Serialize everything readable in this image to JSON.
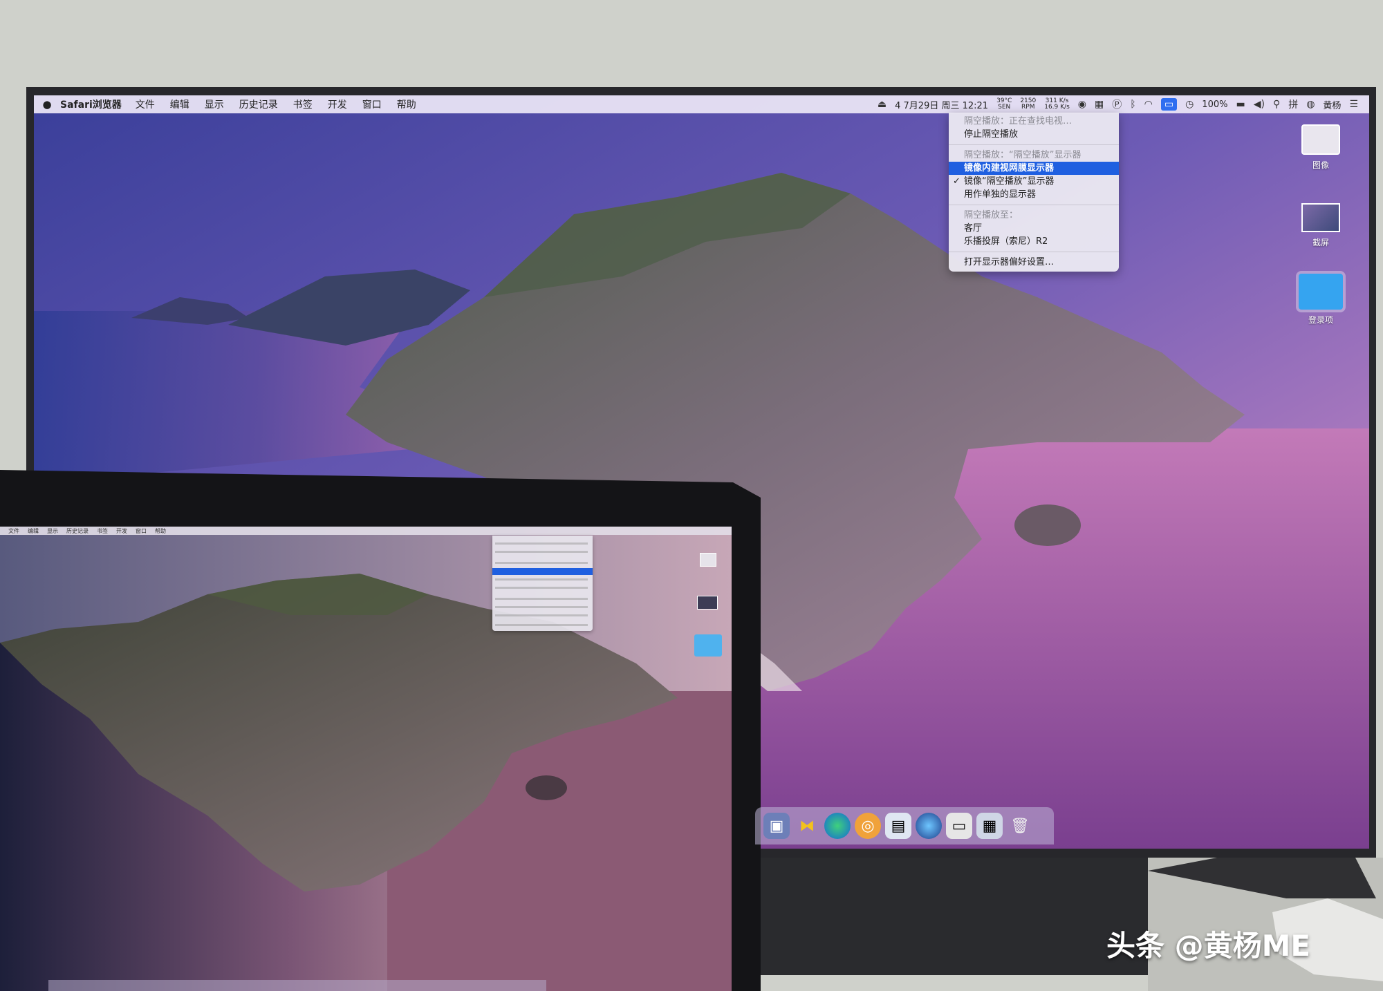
{
  "tv": {
    "menubar": {
      "apple": "",
      "app_name": "Safari浏览器",
      "items": [
        "文件",
        "编辑",
        "显示",
        "历史记录",
        "书签",
        "开发",
        "窗口",
        "帮助"
      ],
      "status": {
        "clock_text": "4  7月29日 周三 12:21",
        "temp": "39°C",
        "temp_unit": "SEN",
        "fan": "2150",
        "fan_unit": "RPM",
        "net_up": "311 K/s",
        "net_down": "16.9 K/s",
        "battery": "100%",
        "user": "黄杨"
      }
    },
    "airplay_menu": {
      "status_header": "隔空播放：正在查找电视…",
      "stop": "停止隔空播放",
      "mode_header": "隔空播放：“隔空播放”显示器",
      "mirror_builtin": "镜像内建视网膜显示器",
      "mirror_airplay": "镜像“隔空播放”显示器",
      "separate": "用作单独的显示器",
      "to_header": "隔空播放至：",
      "device_living_room": "客厅",
      "device_sony": "乐播投屏（索尼）R2",
      "open_prefs": "打开显示器偏好设置…"
    },
    "desktop_icons": [
      {
        "label": "图像"
      },
      {
        "label": "截屏"
      },
      {
        "label": "登录项"
      }
    ]
  },
  "watermark": "头条 @黄杨ME"
}
